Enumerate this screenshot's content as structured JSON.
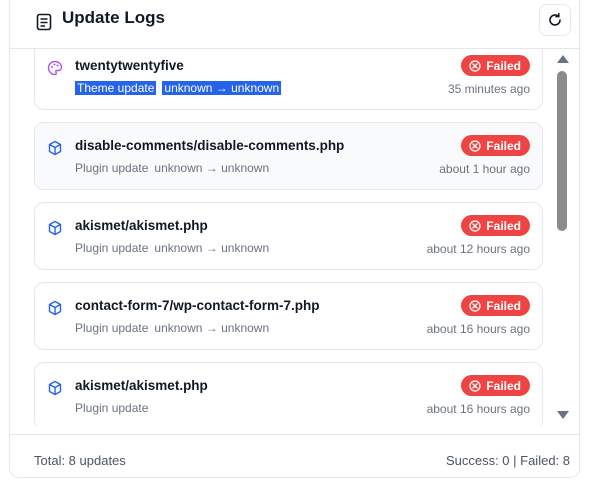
{
  "header": {
    "title": "Update Logs",
    "doc_icon": "document-icon",
    "refresh_icon": "refresh-icon"
  },
  "logs": [
    {
      "name": "twentytwentyfive",
      "type": "Theme update",
      "version": "unknown → unknown",
      "status": "Failed",
      "time": "35 minutes ago",
      "icon": "palette-icon",
      "icon_color": "#a855f7"
    },
    {
      "name": "disable-comments/disable-comments.php",
      "type": "Plugin update",
      "version": "unknown → unknown",
      "status": "Failed",
      "time": "about 1 hour ago",
      "icon": "package-icon",
      "icon_color": "#2563eb"
    },
    {
      "name": "akismet/akismet.php",
      "type": "Plugin update",
      "version": "unknown → unknown",
      "status": "Failed",
      "time": "about 12 hours ago",
      "icon": "package-icon",
      "icon_color": "#2563eb"
    },
    {
      "name": "contact-form-7/wp-contact-form-7.php",
      "type": "Plugin update",
      "version": "unknown → unknown",
      "status": "Failed",
      "time": "about 16 hours ago",
      "icon": "package-icon",
      "icon_color": "#2563eb"
    },
    {
      "name": "akismet/akismet.php",
      "type": "Plugin update",
      "version": "",
      "status": "Failed",
      "time": "about 16 hours ago",
      "icon": "package-icon",
      "icon_color": "#2563eb"
    }
  ],
  "footer": {
    "total": "Total: 8 updates",
    "stats": "Success: 0 | Failed: 8"
  },
  "colors": {
    "failed": "#ef4444",
    "selection": "#2563eb"
  }
}
